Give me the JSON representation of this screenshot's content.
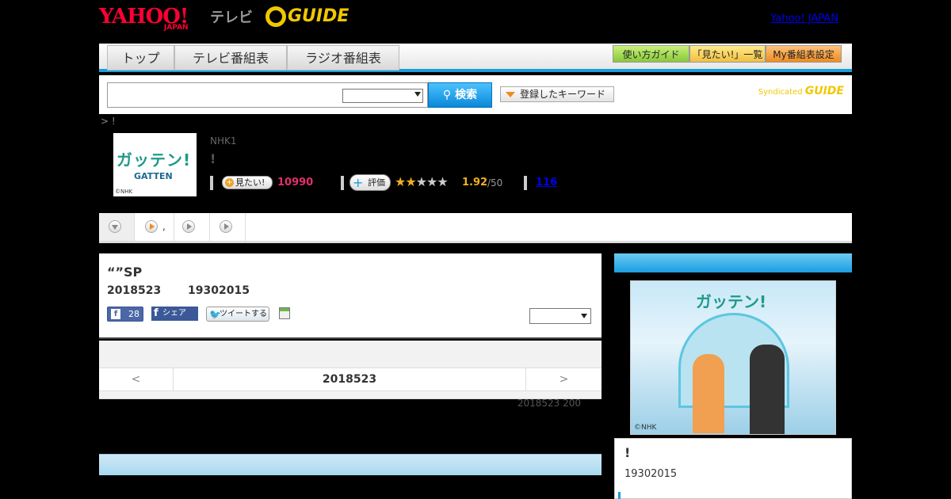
{
  "header": {
    "yahoo_logo": "YAHOO!",
    "japan_logo": "JAPAN",
    "tv_logo": "テレビ",
    "gguide_logo": "GUIDE",
    "yahoo_japan_link": "Yahoo! JAPAN"
  },
  "nav": {
    "tabs": [
      "トップ",
      "テレビ番組表",
      "ラジオ番組表"
    ],
    "buttons": [
      "使い方ガイド",
      "「見たい!」一覧",
      "My番組表設定"
    ]
  },
  "search": {
    "input_value": "",
    "button_label": "検索",
    "keyword_button": "登録したキーワード",
    "syndicated": "Syndicated",
    "syndicated_logo": "GUIDE"
  },
  "breadcrumb": "> !",
  "program": {
    "thumb_title": "ガッテン!",
    "thumb_sub": "GATTEN",
    "thumb_copyright": "©NHK",
    "channel": "NHK1",
    "title": "!",
    "mitai_label": "見たい!",
    "mitai_count": "10990",
    "hyouka_label": "評価",
    "rating": "1.92",
    "rating_max": "/50",
    "comments": "116"
  },
  "tabs": {
    "tab2_label": ","
  },
  "episode": {
    "title": "“”SP",
    "date": "2018523",
    "time": "19302015",
    "fb_count": "28",
    "share_label": "シェア",
    "tweet_label": "ツイートする"
  },
  "date_nav": {
    "prev": "<",
    "date": "2018523",
    "next": ">"
  },
  "updated": "2018523  200",
  "sidebar": {
    "photo_logo": "ガッテン!",
    "photo_copyright": "©NHK",
    "title": "!",
    "time": "19302015"
  },
  "colors": {
    "accent_blue": "#1a9ee0",
    "mitai_pink": "#e0306a",
    "rating_orange": "#f0b020"
  }
}
